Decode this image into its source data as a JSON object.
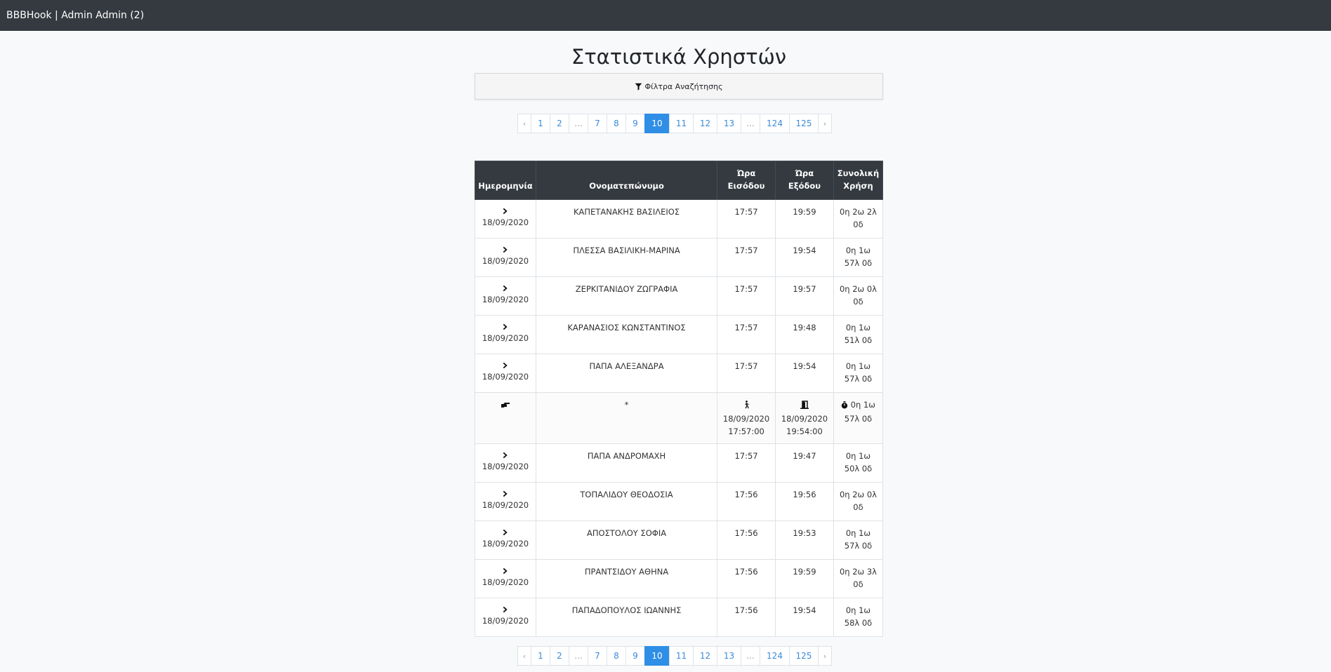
{
  "navbar": {
    "brand": "BBBHook | Admin Admin (2)"
  },
  "page": {
    "title": "Στατιστικά Χρηστών"
  },
  "filters": {
    "label": "Φίλτρα Αναζήτησης"
  },
  "pagination": {
    "prev": "‹",
    "next": "›",
    "pages": [
      {
        "label": "1",
        "w": 28
      },
      {
        "label": "2",
        "w": 28
      },
      {
        "label": "...",
        "w": 28,
        "dots": true
      },
      {
        "label": "7",
        "w": 28
      },
      {
        "label": "8",
        "w": 28
      },
      {
        "label": "9",
        "w": 28
      },
      {
        "label": "10",
        "w": 36,
        "active": true
      },
      {
        "label": "11",
        "w": 35
      },
      {
        "label": "12",
        "w": 35
      },
      {
        "label": "13",
        "w": 35
      },
      {
        "label": "...",
        "w": 28,
        "dots": true
      },
      {
        "label": "124",
        "w": 43
      },
      {
        "label": "125",
        "w": 42
      }
    ]
  },
  "table": {
    "headers": {
      "date": "Ημερομηνία",
      "name": "Ονοματεπώνυμο",
      "in": [
        "Ώρα",
        "Εισόδου"
      ],
      "out": [
        "Ώρα",
        "Εξόδου"
      ],
      "total": [
        "Συνολική",
        "Χρήση"
      ]
    },
    "rows": [
      {
        "date": "18/09/2020",
        "name": "ΚΑΠΕΤΑΝΑΚΗΣ ΒΑΣΙΛΕΙΟΣ",
        "in": "17:57",
        "out": "19:59",
        "total": [
          "0η 2ω 2λ",
          "0δ"
        ]
      },
      {
        "date": "18/09/2020",
        "name": "ΠΛΕΣΣΑ ΒΑΣΙΛΙΚΗ-ΜΑΡΙΝΑ",
        "in": "17:57",
        "out": "19:54",
        "total": [
          "0η 1ω",
          "57λ 0δ"
        ]
      },
      {
        "date": "18/09/2020",
        "name": "ΖΕΡΚΙΤΑΝΙΔΟΥ ΖΩΓΡΑΦΙΑ",
        "in": "17:57",
        "out": "19:57",
        "total": [
          "0η 2ω 0λ",
          "0δ"
        ]
      },
      {
        "date": "18/09/2020",
        "name": "ΚΑΡΑΝΑΣΙΟΣ ΚΩΝΣΤΑΝΤΙΝΟΣ",
        "in": "17:57",
        "out": "19:48",
        "total": [
          "0η 1ω",
          "51λ 0δ"
        ]
      },
      {
        "date": "18/09/2020",
        "name": "ΠΑΠΑ ΑΛΕΞΑΝΔΡΑ",
        "in": "17:57",
        "out": "19:54",
        "total": [
          "0η 1ω",
          "57λ 0δ"
        ]
      }
    ],
    "detail": {
      "name": "*",
      "in": [
        "18/09/2020",
        "17:57:00"
      ],
      "out": [
        "18/09/2020",
        "19:54:00"
      ],
      "total": [
        "0η 1ω",
        "57λ 0δ"
      ]
    },
    "rows2": [
      {
        "date": "18/09/2020",
        "name": "ΠΑΠΑ ΑΝΔΡΟΜΑΧΗ",
        "in": "17:57",
        "out": "19:47",
        "total": [
          "0η 1ω",
          "50λ 0δ"
        ]
      },
      {
        "date": "18/09/2020",
        "name": "ΤΟΠΑΛΙΔΟΥ ΘΕΟΔΟΣΙΑ",
        "in": "17:56",
        "out": "19:56",
        "total": [
          "0η 2ω 0λ",
          "0δ"
        ]
      },
      {
        "date": "18/09/2020",
        "name": "ΑΠΟΣΤΟΛΟΥ ΣΟΦΙΑ",
        "in": "17:56",
        "out": "19:53",
        "total": [
          "0η 1ω",
          "57λ 0δ"
        ]
      },
      {
        "date": "18/09/2020",
        "name": "ΠΡΑΝΤΣΙΔΟΥ ΑΘΗΝΑ",
        "in": "17:56",
        "out": "19:59",
        "total": [
          "0η 2ω 3λ",
          "0δ"
        ]
      },
      {
        "date": "18/09/2020",
        "name": "ΠΑΠΑΔΟΠΟΥΛΟΣ ΙΩΑΝΝΗΣ",
        "in": "17:56",
        "out": "19:54",
        "total": [
          "0η 1ω",
          "58λ 0δ"
        ]
      }
    ]
  }
}
